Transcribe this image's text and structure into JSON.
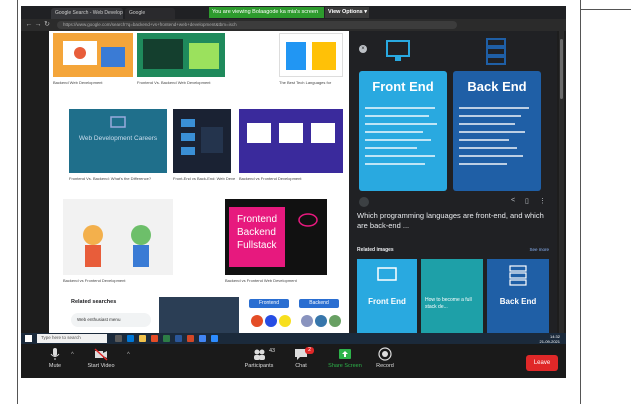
{
  "screen_share": {
    "banner": "You are viewing Bolaagode ka mia's screen",
    "view_options": "View Options"
  },
  "browser": {
    "tabs": [
      "Google Search - Web Development",
      "Google"
    ],
    "url": "https://www.google.com/search?q=backend+vs+frontend+web+development&tbm=isch"
  },
  "results": {
    "captions": [
      "Backend Web Development",
      "Frontend Vs. Backend Web Development",
      "The Best Tech Languages for",
      "Frontend Vs. Backend: What's the Difference?",
      "Front-End vs Back-End: Web Development",
      "Backend vs Frontend Development",
      "Backend vs Frontend Web Development"
    ],
    "thumb_texts": {
      "web_dev_careers": "Web Development Careers",
      "front_back_full": [
        "Frontend",
        "Backend",
        "Fullstack"
      ],
      "frontend_chip": "Frontend",
      "backend_chip": "Backend"
    },
    "related_searches_label": "Related searches",
    "related_item": "Web enthusiast menu"
  },
  "side_panel": {
    "front_end_title": "Front End",
    "back_end_title": "Back End",
    "question": "Which programming languages are front-end, and which are back-end ...",
    "related_images_label": "Related images",
    "see_more": "See more",
    "related_cards": [
      "Front End",
      "How to become a full stack de...",
      "Back End"
    ]
  },
  "taskbar": {
    "search_placeholder": "Type here to search",
    "time": "14:32",
    "date": "21-09-2021"
  },
  "zoom_controls": {
    "mute": "Mute",
    "start_video": "Start Video",
    "participants": "Participants",
    "participants_count": "43",
    "chat": "Chat",
    "chat_badge": "2",
    "share_screen": "Share Screen",
    "record": "Record",
    "leave": "Leave"
  },
  "colors": {
    "banner_green": "#2d9b2d",
    "leave_red": "#e02828",
    "front_end_card": "#29a9e0",
    "back_end_card": "#1f5fa6"
  }
}
